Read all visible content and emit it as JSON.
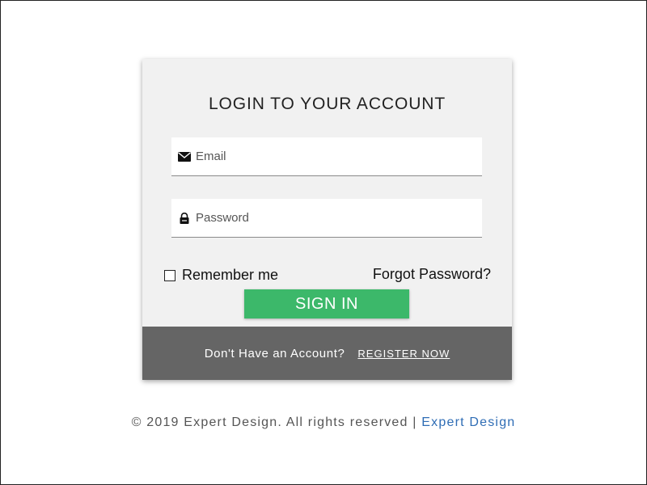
{
  "login": {
    "title": "LOGIN TO YOUR ACCOUNT",
    "email_placeholder": "Email",
    "password_placeholder": "Password",
    "email_icon": "envelope-icon",
    "password_icon": "lock-icon",
    "remember_label": "Remember me",
    "forgot_label": "Forgot Password?",
    "signin_label": "SIGN IN"
  },
  "card_footer": {
    "prompt": "Don't Have an Account?",
    "register_label": "REGISTER NOW"
  },
  "page_footer": {
    "copyright_text": "© 2019 Expert Design. All rights reserved |",
    "brand_link": "Expert Design"
  },
  "colors": {
    "card_background": "#f1f1f1",
    "signin_button": "#3cb86a",
    "footer_band": "#656565",
    "link": "#2f6db5"
  }
}
